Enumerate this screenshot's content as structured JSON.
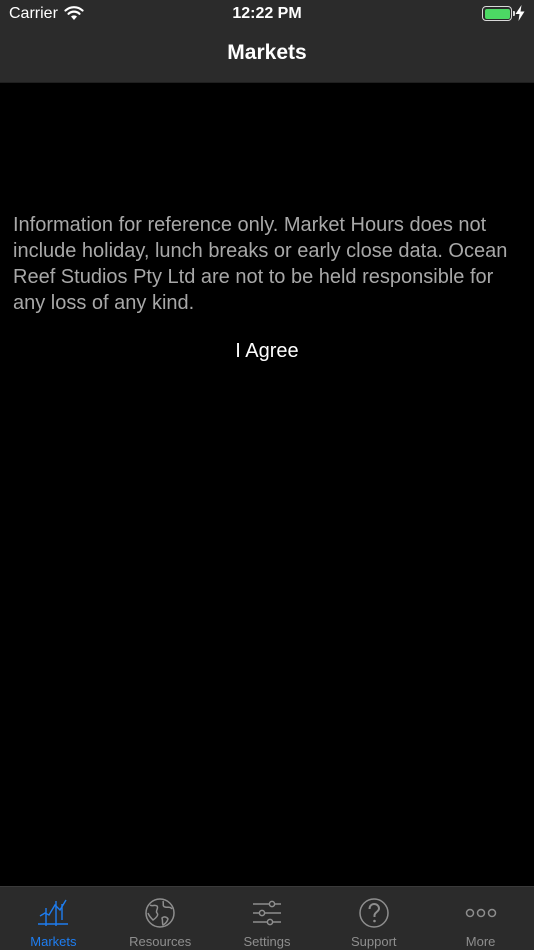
{
  "status_bar": {
    "carrier": "Carrier",
    "time": "12:22 PM",
    "battery_color": "#4cd964"
  },
  "nav": {
    "title": "Markets"
  },
  "content": {
    "disclaimer": "Information for reference only. Market Hours does not include holiday, lunch breaks or early close data. Ocean Reef Studios Pty Ltd are not to be held responsible for any loss of any kind.",
    "agree_label": "I Agree"
  },
  "tabbar": {
    "active_color": "#1e7df0",
    "inactive_color": "#8e8e8e",
    "tabs": [
      {
        "label": "Markets",
        "icon": "chart-icon",
        "active": true
      },
      {
        "label": "Resources",
        "icon": "globe-icon",
        "active": false
      },
      {
        "label": "Settings",
        "icon": "sliders-icon",
        "active": false
      },
      {
        "label": "Support",
        "icon": "question-icon",
        "active": false
      },
      {
        "label": "More",
        "icon": "more-icon",
        "active": false
      }
    ]
  }
}
